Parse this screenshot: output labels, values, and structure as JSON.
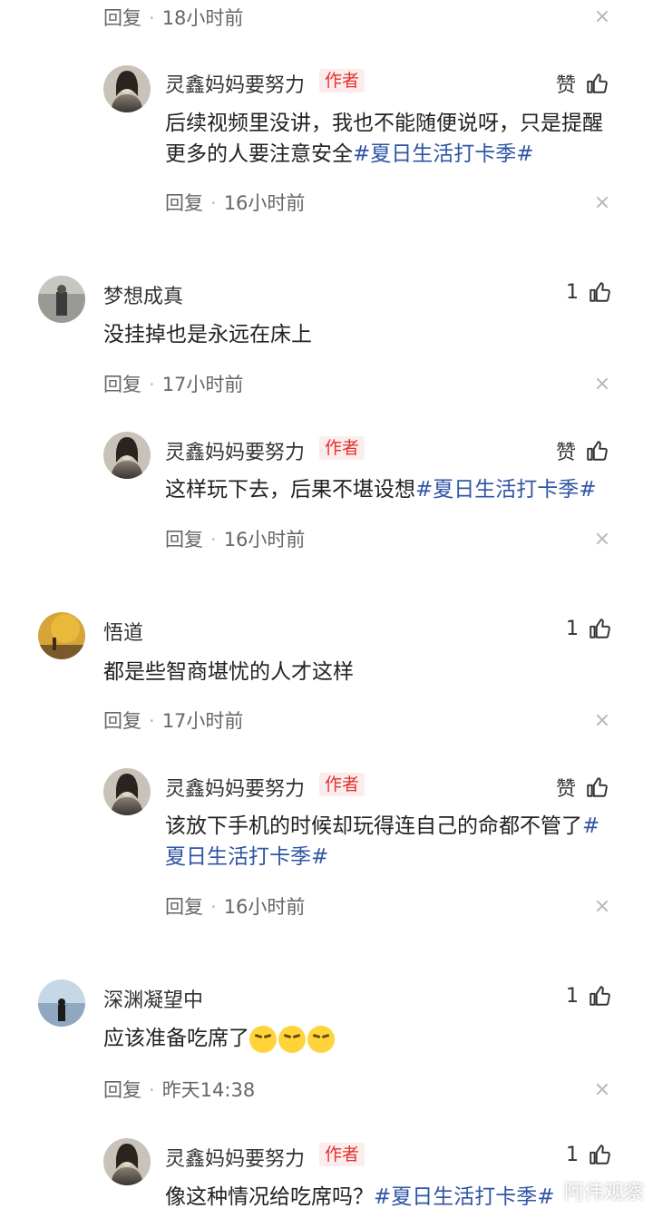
{
  "top_meta": {
    "reply": "回复",
    "time": "18小时前"
  },
  "comments": [
    {
      "user": "梦想成真",
      "likes": "1",
      "text": "没挂掉也是永远在床上",
      "reply_label": "回复",
      "time": "17小时前",
      "author_reply": {
        "user": "灵鑫妈妈要努力",
        "badge": "作者",
        "like_label": "赞",
        "text": "这样玩下去，后果不堪设想",
        "hashtag": "#夏日生活打卡季#",
        "reply_label": "回复",
        "time": "16小时前"
      }
    },
    {
      "user": "悟道",
      "likes": "1",
      "text": "都是些智商堪忧的人才这样",
      "reply_label": "回复",
      "time": "17小时前",
      "author_reply": {
        "user": "灵鑫妈妈要努力",
        "badge": "作者",
        "like_label": "赞",
        "text_line1": "该放下手机的时候却玩得连自己的命都不管了",
        "hashtag_part1": "#",
        "hashtag_part2": "夏日生活打卡季#",
        "reply_label": "回复",
        "time": "16小时前"
      }
    },
    {
      "user": "深渊凝望中",
      "likes": "1",
      "text": "应该准备吃席了",
      "reply_label": "回复",
      "time": "昨天14:38",
      "author_reply": {
        "user": "灵鑫妈妈要努力",
        "badge": "作者",
        "likes": "1",
        "text": "像这种情况给吃席吗？",
        "hashtag": "#夏日生活打卡季#"
      }
    }
  ],
  "first_author_reply": {
    "user": "灵鑫妈妈要努力",
    "badge": "作者",
    "like_label": "赞",
    "text_line1": "后续视频里没讲，我也不能随便说呀，只是提醒",
    "text_line2": "更多的人要注意安全",
    "hashtag": "#夏日生活打卡季#",
    "reply_label": "回复",
    "time": "16小时前"
  },
  "watermark": "阿伟观察",
  "colors": {
    "hashtag": "#2f55a4",
    "badge_text": "#e0322f",
    "badge_bg": "#fdecec"
  },
  "icons": {
    "like": "thumbs-up-icon",
    "close": "close-icon"
  }
}
